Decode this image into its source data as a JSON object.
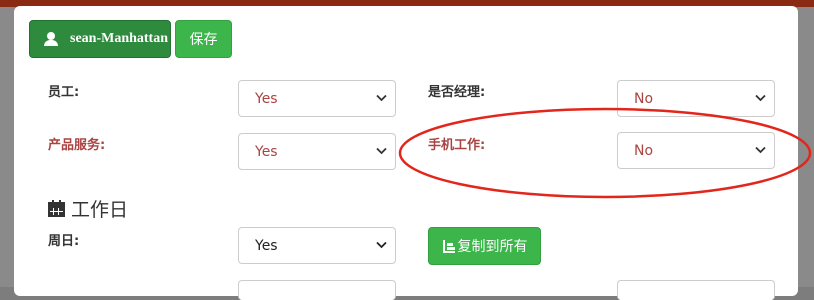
{
  "toolbar": {
    "user_label": "sean-Manhattan",
    "save_label": "保存"
  },
  "form": {
    "employee_label": "员工:",
    "employee_value": "Yes",
    "manager_label": "是否经理:",
    "manager_value": "No",
    "product_label": "产品服务:",
    "product_value": "Yes",
    "mobile_label": "手机工作:",
    "mobile_value": "No"
  },
  "workdays": {
    "title": "工作日",
    "sunday_label": "周日:",
    "sunday_value": "Yes",
    "copy_label": "复制到所有"
  },
  "colors": {
    "primary_green": "#2e8b3d",
    "success_green": "#3cb54a",
    "error_red": "#a94442",
    "annotation_red": "#e3261b"
  }
}
